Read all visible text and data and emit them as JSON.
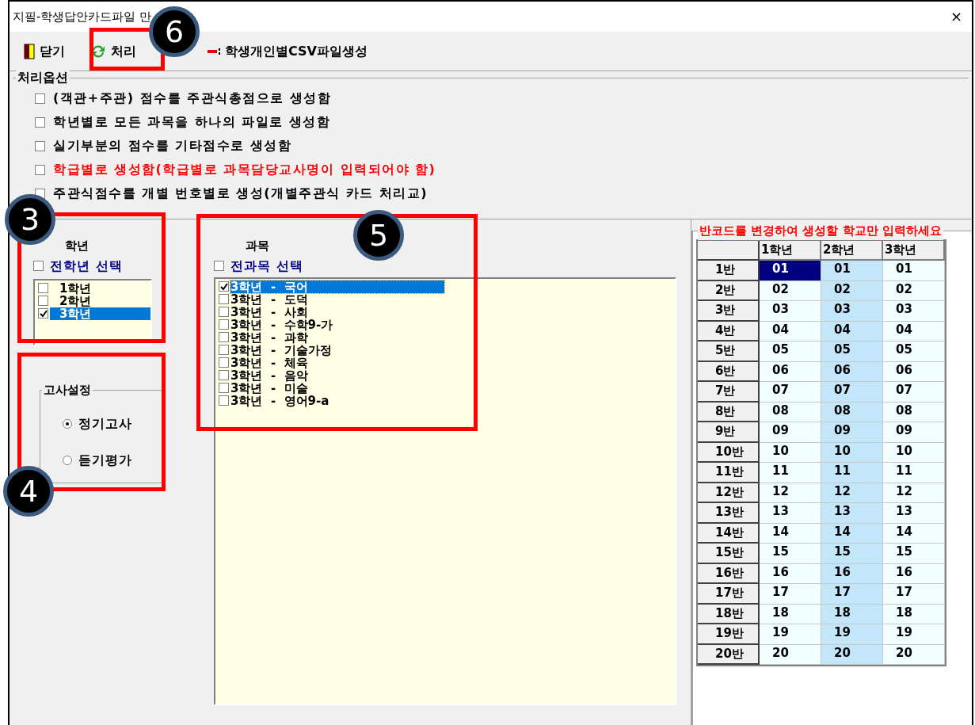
{
  "window": {
    "title": "지필-학생답안카드파일 만",
    "close": "×"
  },
  "toolbar": [
    {
      "kind": "door",
      "label": "닫기"
    },
    {
      "kind": "refresh",
      "label": "처리"
    },
    {
      "kind": "file",
      "label": "학생개인별CSV파일생성"
    }
  ],
  "options": {
    "title": "처리옵션",
    "items": [
      {
        "label": "(객관+주관) 점수를 주관식총점으로 생성함",
        "checked": false,
        "warning": false
      },
      {
        "label": "학년별로 모든 과목을 하나의 파일로 생성함",
        "checked": false,
        "warning": false
      },
      {
        "label": "실기부분의 점수를 기타점수로 생성함",
        "checked": false,
        "warning": false
      },
      {
        "label": "학급별로 생성함(학급별로 과목담당교사명이 입력되어야 함)",
        "checked": false,
        "warning": true
      },
      {
        "label": "주관식점수를 개별 번호별로 생성(개별주관식 카드 처리교)",
        "checked": false,
        "warning": false
      }
    ]
  },
  "grades": {
    "title": "학년",
    "select_all": {
      "label": "전학년 선택",
      "checked": false
    },
    "items": [
      {
        "label": "1학년",
        "checked": false,
        "selected": false
      },
      {
        "label": "2학년",
        "checked": false,
        "selected": false
      },
      {
        "label": "3학년",
        "checked": true,
        "selected": true
      }
    ]
  },
  "exam": {
    "title": "고사설정",
    "items": [
      {
        "label": "정기고사",
        "selected": true
      },
      {
        "label": "듣기평가",
        "selected": false
      }
    ]
  },
  "subjects": {
    "title": "과목",
    "select_all": {
      "label": "전과목 선택",
      "checked": false
    },
    "items": [
      {
        "label": "3학년  -  국어",
        "checked": true,
        "selected": true
      },
      {
        "label": "3학년  -  도덕",
        "checked": false,
        "selected": false
      },
      {
        "label": "3학년  -  사회",
        "checked": false,
        "selected": false
      },
      {
        "label": "3학년  -  수학9-가",
        "checked": false,
        "selected": false
      },
      {
        "label": "3학년  -  과학",
        "checked": false,
        "selected": false
      },
      {
        "label": "3학년  -  기술가정",
        "checked": false,
        "selected": false
      },
      {
        "label": "3학년  -  체육",
        "checked": false,
        "selected": false
      },
      {
        "label": "3학년  -  음악",
        "checked": false,
        "selected": false
      },
      {
        "label": "3학년  -  미술",
        "checked": false,
        "selected": false
      },
      {
        "label": "3학년  -  영어9-a",
        "checked": false,
        "selected": false
      }
    ]
  },
  "class_codes": {
    "title": "반코드를 변경하여 생성할 학교만 입력하세요",
    "columns": [
      {
        "label": "1학년",
        "selected": false
      },
      {
        "label": "2학년",
        "selected": true
      },
      {
        "label": "3학년",
        "selected": false
      }
    ],
    "rows": [
      {
        "label": "1반",
        "cells": [
          "01",
          "01",
          "01"
        ],
        "current": [
          true,
          false,
          false
        ]
      },
      {
        "label": "2반",
        "cells": [
          "02",
          "02",
          "02"
        ]
      },
      {
        "label": "3반",
        "cells": [
          "03",
          "03",
          "03"
        ]
      },
      {
        "label": "4반",
        "cells": [
          "04",
          "04",
          "04"
        ]
      },
      {
        "label": "5반",
        "cells": [
          "05",
          "05",
          "05"
        ]
      },
      {
        "label": "6반",
        "cells": [
          "06",
          "06",
          "06"
        ]
      },
      {
        "label": "7반",
        "cells": [
          "07",
          "07",
          "07"
        ]
      },
      {
        "label": "8반",
        "cells": [
          "08",
          "08",
          "08"
        ]
      },
      {
        "label": "9반",
        "cells": [
          "09",
          "09",
          "09"
        ]
      },
      {
        "label": "10반",
        "cells": [
          "10",
          "10",
          "10"
        ]
      },
      {
        "label": "11반",
        "cells": [
          "11",
          "11",
          "11"
        ]
      },
      {
        "label": "12반",
        "cells": [
          "12",
          "12",
          "12"
        ]
      },
      {
        "label": "13반",
        "cells": [
          "13",
          "13",
          "13"
        ]
      },
      {
        "label": "14반",
        "cells": [
          "14",
          "14",
          "14"
        ]
      },
      {
        "label": "15반",
        "cells": [
          "15",
          "15",
          "15"
        ]
      },
      {
        "label": "16반",
        "cells": [
          "16",
          "16",
          "16"
        ]
      },
      {
        "label": "17반",
        "cells": [
          "17",
          "17",
          "17"
        ]
      },
      {
        "label": "18반",
        "cells": [
          "18",
          "18",
          "18"
        ]
      },
      {
        "label": "19반",
        "cells": [
          "19",
          "19",
          "19"
        ]
      },
      {
        "label": "20반",
        "cells": [
          "20",
          "20",
          "20"
        ]
      }
    ]
  },
  "callouts": [
    {
      "number": "6"
    },
    {
      "number": "3"
    },
    {
      "number": "5"
    },
    {
      "number": "4"
    }
  ]
}
